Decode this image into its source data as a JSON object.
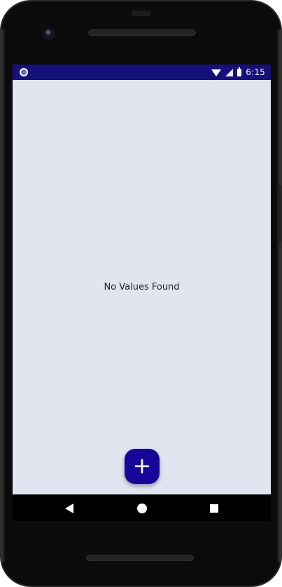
{
  "status_bar": {
    "time": "6:15",
    "icons": [
      "notification-dot-icon",
      "wifi-icon",
      "cell-signal-icon",
      "battery-icon"
    ],
    "background_color": "#16107a"
  },
  "main": {
    "empty_message": "No Values Found",
    "background_color": "#e1e5ef"
  },
  "fab": {
    "label": "+",
    "icon": "plus-icon",
    "color": "#17069a"
  },
  "nav_bar": {
    "buttons": [
      "back-icon",
      "home-icon",
      "recents-icon"
    ]
  }
}
